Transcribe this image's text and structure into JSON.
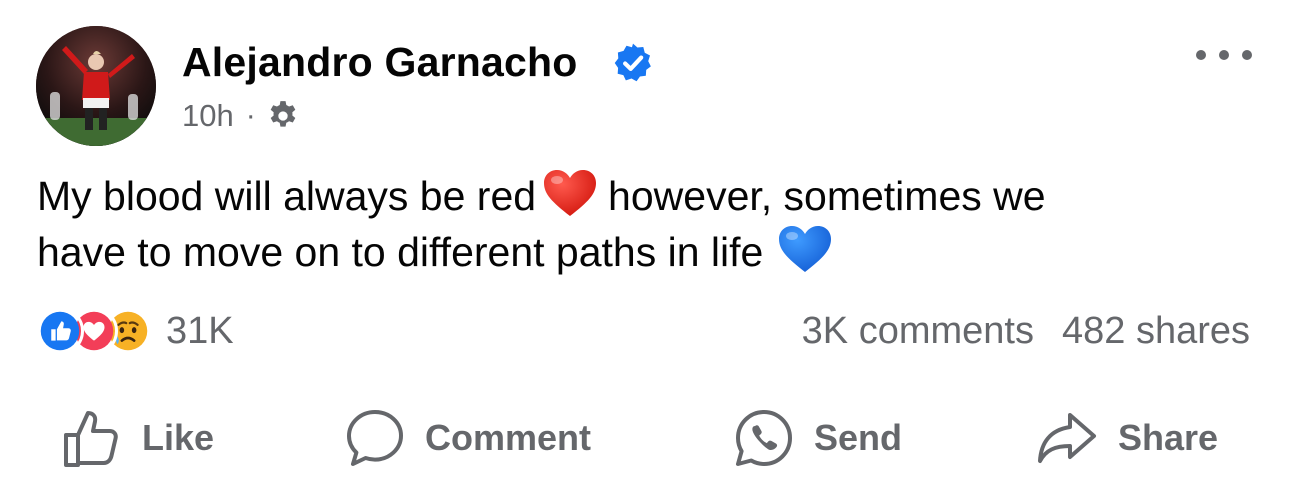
{
  "post": {
    "author": "Alejandro Garnacho",
    "time": "10h",
    "separator": "·",
    "text_line1_a": "My blood will always be red",
    "text_line1_b": "however, sometimes we",
    "text_line2": "have to move on to different paths in life",
    "icons": {
      "verified": "verified-badge-icon",
      "audience": "gear-icon",
      "more": "more-options-icon",
      "emoji_1": "red-heart",
      "emoji_2": "blue-heart"
    }
  },
  "stats": {
    "reaction_count": "31K",
    "comments": "3K comments",
    "shares": "482 shares",
    "reaction_types": [
      "like",
      "love",
      "sad"
    ]
  },
  "actions": {
    "like": "Like",
    "comment": "Comment",
    "send": "Send",
    "share": "Share"
  },
  "colors": {
    "verified": "#1877f2",
    "like": "#1877f2",
    "love": "#f33e58",
    "sad": "#f7b125",
    "red_heart": "#e3241b",
    "blue_heart": "#1d75e8",
    "secondary_text": "#65676b"
  }
}
